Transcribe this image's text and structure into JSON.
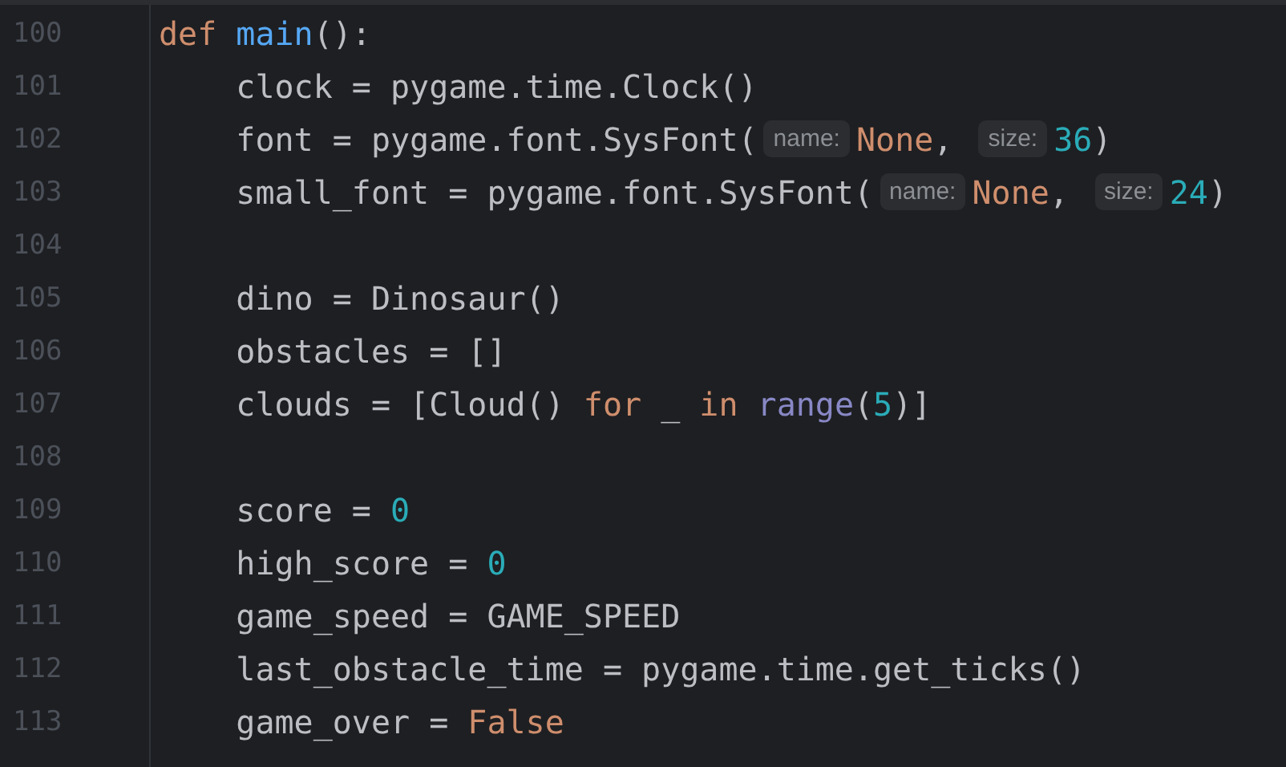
{
  "editor": {
    "lines": [
      {
        "number": "100",
        "tokens": [
          {
            "kind": "keyword",
            "text": "def "
          },
          {
            "kind": "function",
            "text": "main"
          },
          {
            "kind": "plain",
            "text": "():"
          }
        ]
      },
      {
        "number": "101",
        "tokens": [
          {
            "kind": "plain",
            "text": "    clock = pygame.time.Clock()"
          }
        ]
      },
      {
        "number": "102",
        "tokens": [
          {
            "kind": "plain",
            "text": "    font = pygame.font.SysFont("
          },
          {
            "kind": "hint",
            "text": "name:"
          },
          {
            "kind": "keyword",
            "text": "None"
          },
          {
            "kind": "plain",
            "text": ", "
          },
          {
            "kind": "hint",
            "text": "size:"
          },
          {
            "kind": "number",
            "text": "36"
          },
          {
            "kind": "plain",
            "text": ")"
          }
        ]
      },
      {
        "number": "103",
        "tokens": [
          {
            "kind": "plain",
            "text": "    small_font = pygame.font.SysFont("
          },
          {
            "kind": "hint",
            "text": "name:"
          },
          {
            "kind": "keyword",
            "text": "None"
          },
          {
            "kind": "plain",
            "text": ", "
          },
          {
            "kind": "hint",
            "text": "size:"
          },
          {
            "kind": "number",
            "text": "24"
          },
          {
            "kind": "plain",
            "text": ")"
          }
        ]
      },
      {
        "number": "104"
      },
      {
        "number": "105",
        "tokens": [
          {
            "kind": "plain",
            "text": "    dino = Dinosaur()"
          }
        ]
      },
      {
        "number": "106",
        "tokens": [
          {
            "kind": "plain",
            "text": "    obstacles = []"
          }
        ]
      },
      {
        "number": "107",
        "tokens": [
          {
            "kind": "plain",
            "text": "    clouds = [Cloud() "
          },
          {
            "kind": "keyword",
            "text": "for"
          },
          {
            "kind": "plain",
            "text": " _ "
          },
          {
            "kind": "keyword",
            "text": "in "
          },
          {
            "kind": "builtin",
            "text": "range"
          },
          {
            "kind": "plain",
            "text": "("
          },
          {
            "kind": "number",
            "text": "5"
          },
          {
            "kind": "plain",
            "text": ")]"
          }
        ]
      },
      {
        "number": "108"
      },
      {
        "number": "109",
        "tokens": [
          {
            "kind": "plain",
            "text": "    score = "
          },
          {
            "kind": "number",
            "text": "0"
          }
        ]
      },
      {
        "number": "110",
        "tokens": [
          {
            "kind": "plain",
            "text": "    high_score = "
          },
          {
            "kind": "number",
            "text": "0"
          }
        ]
      },
      {
        "number": "111",
        "tokens": [
          {
            "kind": "plain",
            "text": "    game_speed = GAME_SPEED"
          }
        ]
      },
      {
        "number": "112",
        "tokens": [
          {
            "kind": "plain",
            "text": "    last_obstacle_time = pygame.time.get_ticks()"
          }
        ]
      },
      {
        "number": "113",
        "tokens": [
          {
            "kind": "plain",
            "text": "    game_over = "
          },
          {
            "kind": "keyword",
            "text": "False"
          }
        ]
      }
    ]
  }
}
